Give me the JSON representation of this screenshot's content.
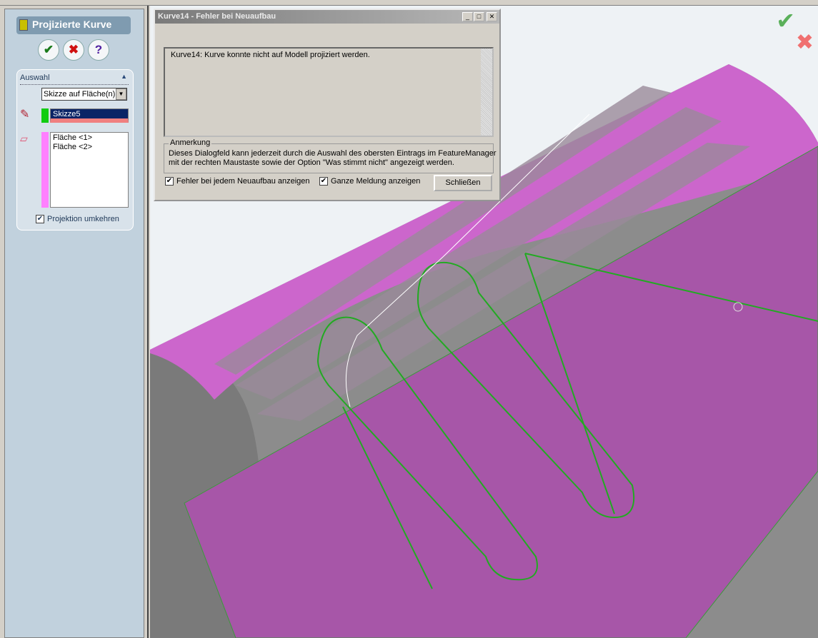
{
  "property_manager": {
    "title": "Projizierte Kurve",
    "ok_icon": "✔",
    "cancel_icon": "✖",
    "help_icon": "?",
    "section": "Auswahl",
    "type_select": "Skizze auf Fläche(n)",
    "sketch": "Skizze5",
    "faces": [
      "Fläche <1>",
      "Fläche <2>"
    ],
    "reverse_label": "Projektion umkehren",
    "reverse_checked": true
  },
  "dialog": {
    "title": "Kurve14 - Fehler bei Neuaufbau",
    "message": "Kurve14: Kurve konnte nicht auf Modell projiziert werden.",
    "group_label": "Anmerkung",
    "note_line1": "Dieses Dialogfeld kann jederzeit durch die Auswahl des obersten Eintrags im FeatureManager",
    "note_line2": "mit der rechten Maustaste sowie der Option \"Was stimmt nicht\" angezeigt werden.",
    "check1": "Fehler bei jedem Neuaufbau anzeigen",
    "check2": "Ganze Meldung anzeigen",
    "close": "Schließen"
  },
  "colors": {
    "plane": "#a756a8",
    "face": "#cc66cc",
    "body": "#8c8c8c",
    "sketch": "#22aa22"
  }
}
